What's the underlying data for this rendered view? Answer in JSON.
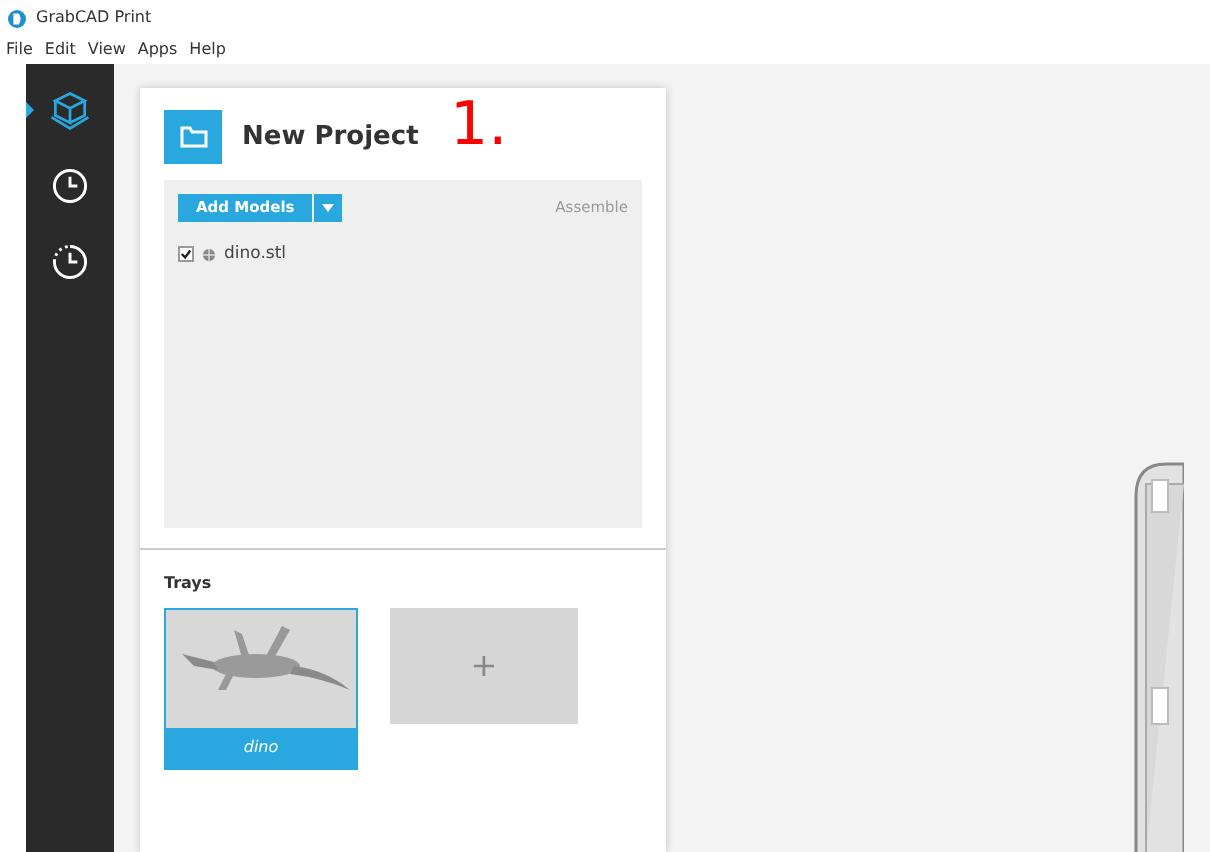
{
  "window": {
    "title": "GrabCAD Print"
  },
  "menu": [
    "File",
    "Edit",
    "View",
    "Apps",
    "Help"
  ],
  "sidebar": {
    "items": [
      {
        "kind": "cube",
        "selected": true
      },
      {
        "kind": "clock",
        "selected": false
      },
      {
        "kind": "history",
        "selected": false
      }
    ]
  },
  "project": {
    "title": "New Project",
    "add_button": "Add Models",
    "assemble": "Assemble",
    "models": [
      {
        "name": "dino.stl",
        "checked": true
      }
    ]
  },
  "trays": {
    "heading": "Trays",
    "items": [
      {
        "label": "dino",
        "selected": true
      }
    ],
    "add_label": "+"
  },
  "annotation": "1."
}
